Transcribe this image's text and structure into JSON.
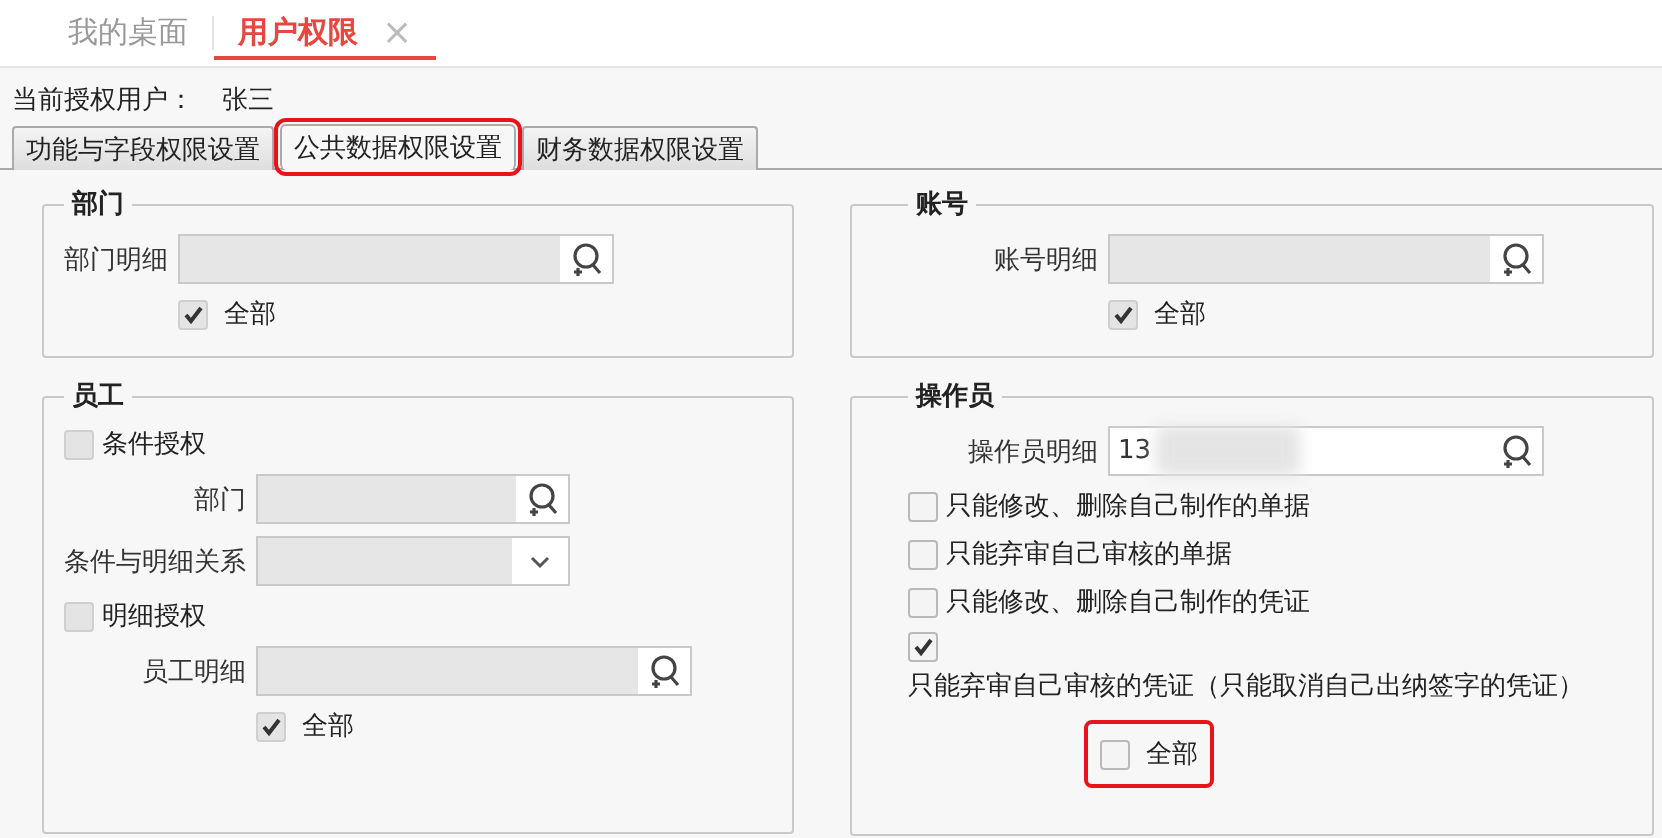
{
  "tabs": [
    {
      "label": "我的桌面",
      "selected": false
    },
    {
      "label": "用户权限",
      "selected": true,
      "close_glyph": "×"
    }
  ],
  "current_user": {
    "label": "当前授权用户：",
    "value": "张三"
  },
  "sub_tabs": [
    {
      "label": "功能与字段权限设置",
      "selected": false,
      "highlighted": false
    },
    {
      "label": "公共数据权限设置",
      "selected": true,
      "highlighted": true
    },
    {
      "label": "财务数据权限设置",
      "selected": false,
      "highlighted": false
    }
  ],
  "columns": [
    {
      "groups": [
        {
          "title": "部门",
          "rows": [
            {
              "kind": "lookup",
              "label": "部门明细",
              "disabled": true
            },
            {
              "kind": "subcheck",
              "label": "全部",
              "checked": true,
              "disabled": true,
              "highlighted": false
            }
          ]
        },
        {
          "title": "员工",
          "rows": [
            {
              "kind": "checkbox",
              "label": "条件授权",
              "checked": false,
              "disabled": true
            },
            {
              "kind": "lookup",
              "label": "部门",
              "disabled": true
            },
            {
              "kind": "dropdown",
              "label": "条件与明细关系",
              "disabled": true
            },
            {
              "kind": "checkbox",
              "label": "明细授权",
              "checked": false,
              "disabled": true
            },
            {
              "kind": "lookup",
              "label": "员工明细",
              "disabled": true,
              "wide": true
            },
            {
              "kind": "subcheck",
              "label": "全部",
              "checked": true,
              "disabled": true,
              "highlighted": false
            }
          ]
        }
      ]
    },
    {
      "groups": [
        {
          "title": "账号",
          "rows": [
            {
              "kind": "lookup",
              "label": "账号明细",
              "disabled": true
            },
            {
              "kind": "subcheck",
              "label": "全部",
              "checked": true,
              "disabled": true,
              "highlighted": false
            }
          ]
        },
        {
          "title": "操作员",
          "rows": [
            {
              "kind": "lookup",
              "label": "操作员明细",
              "disabled": false,
              "value": "13",
              "redacted": true
            },
            {
              "kind": "checkbox",
              "label": "只能修改、删除自己制作的单据",
              "checked": false,
              "disabled": false
            },
            {
              "kind": "checkbox",
              "label": "只能弃审自己审核的单据",
              "checked": false,
              "disabled": false
            },
            {
              "kind": "checkbox",
              "label": "只能修改、删除自己制作的凭证",
              "checked": false,
              "disabled": false
            },
            {
              "kind": "stacked",
              "label": "只能弃审自己审核的凭证（只能取消自己出纳签字的凭证）",
              "checked": true,
              "disabled": false
            },
            {
              "kind": "subcheck",
              "label": "全部",
              "checked": false,
              "disabled": false,
              "highlighted": true
            }
          ]
        }
      ]
    }
  ]
}
